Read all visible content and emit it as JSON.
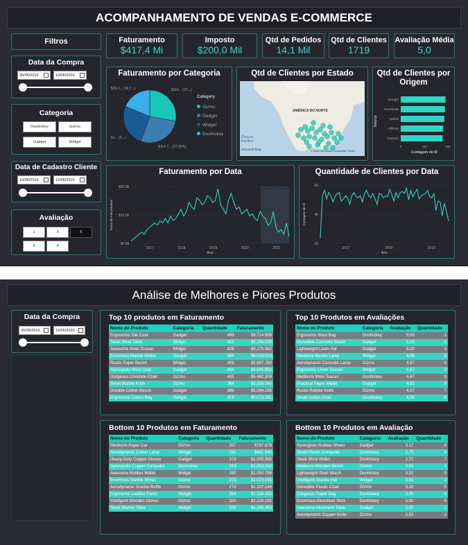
{
  "header": {
    "title": "ACOMPANHAMENTO DE VENDAS E-COMMERCE"
  },
  "filters": {
    "title": "Filtros",
    "data_compra": {
      "label": "Data da Compra",
      "start": "30/06/2016",
      "end": "19/06/2020"
    },
    "categoria": {
      "label": "Categoria",
      "options": [
        "Doohickey",
        "Gizmo",
        "Gadget",
        "Widget"
      ]
    },
    "data_cadastro": {
      "label": "Data de Cadastro Cliente",
      "start": "19/06/2016",
      "end": "19/06/2019"
    },
    "avaliacao": {
      "label": "Avaliação",
      "options": [
        "1",
        "3",
        "5",
        "2",
        "4"
      ],
      "selected": "5"
    }
  },
  "kpis": [
    {
      "label": "Faturamento",
      "value": "$417,4 Mi"
    },
    {
      "label": "Imposto",
      "value": "$200,0 Mil"
    },
    {
      "label": "Qtd de Pedidos",
      "value": "14,1 Mil"
    },
    {
      "label": "Qtd de Clientes",
      "value": "1719"
    },
    {
      "label": "Avaliação Média",
      "value": "5,0"
    }
  ],
  "pie": {
    "title": "Faturamento por Categoria",
    "legend_title": "Category",
    "labels": [
      "$116... (27...)",
      "$78.2... (18.7...)",
      "$1... (2...)",
      "$114.7... (27.69%)"
    ]
  },
  "map": {
    "title": "Qtd de Clientes por Estado",
    "region_label": "AMÉRICA DO NORTE",
    "ocean_label": "Oceano Pacífico",
    "brand": "Microsoft Bing",
    "copyright": "© 2024 Microsoft Corporation  Terms"
  },
  "colors": {
    "accent": "#3fd8c8",
    "gizmo": "#17c7b7",
    "gadget": "#3b7fb0",
    "widget": "#1a5c96",
    "doohickey": "#3bb0e8"
  },
  "origem": {
    "title": "Qtd de Clientes por Origem",
    "ylabel": "Source",
    "xlabel": "Contagem de ID",
    "ticks": [
      "0",
      "200",
      "400"
    ]
  },
  "fat_data": {
    "title": "Faturamento por Data",
    "ylabel": "Soma de Faturamento",
    "xlabel": "Ano",
    "yticks": [
      "$20 Mi",
      "$10 Mi",
      "$0 Mi"
    ],
    "xticks": [
      "2017",
      "2018",
      "2019",
      "2020",
      "2021"
    ]
  },
  "qtd_data": {
    "title": "Quantidade de Clientes por Data",
    "ylabel": "Contagem de ID",
    "xlabel": "Ano",
    "yticks": [
      "60",
      "40",
      "20"
    ],
    "xticks": [
      "2017",
      "2018",
      "2019"
    ]
  },
  "chart_data": [
    {
      "type": "pie",
      "title": "Faturamento por Categoria",
      "categories": [
        "Gizmo",
        "Gadget",
        "Widget",
        "Doohickey"
      ],
      "values": [
        27.9,
        27.69,
        25.7,
        18.7
      ]
    },
    {
      "type": "bar",
      "title": "Qtd de Clientes por Origem",
      "categories": [
        "Google",
        "Facebook",
        "Twitter",
        "Affiliate",
        "Organic"
      ],
      "values": [
        380,
        375,
        370,
        360,
        355
      ],
      "xlim": [
        0,
        400
      ]
    },
    {
      "type": "line",
      "title": "Faturamento por Data",
      "xlabel": "Ano",
      "ylabel": "Soma de Faturamento",
      "ylim": [
        0,
        25
      ],
      "series": [
        {
          "values": [
            1,
            2,
            3,
            4,
            5,
            4,
            6,
            7,
            8,
            9,
            8,
            10,
            9,
            11,
            9,
            12,
            10,
            11,
            13,
            15,
            12,
            14,
            18,
            16,
            15,
            20,
            19,
            17,
            18,
            21,
            20,
            18,
            19,
            24,
            17,
            15,
            13,
            19,
            22,
            18,
            15,
            16,
            13,
            14,
            15,
            12,
            13,
            11,
            10,
            14,
            12,
            11,
            8,
            9,
            14,
            7,
            5,
            6,
            4,
            9,
            3
          ]
        }
      ]
    },
    {
      "type": "line",
      "title": "Quantidade de Clientes por Data",
      "xlabel": "Ano",
      "ylabel": "Contagem de ID",
      "ylim": [
        10,
        65
      ],
      "series": [
        {
          "values": [
            15,
            55,
            60,
            52,
            58,
            55,
            49,
            54,
            57,
            58,
            50,
            52,
            55,
            53,
            47,
            55,
            58,
            54,
            53,
            55,
            49,
            57,
            60,
            55,
            53,
            57,
            52,
            47,
            57,
            56,
            53,
            55,
            54,
            61,
            56,
            50,
            58,
            53,
            58,
            59,
            57,
            62,
            51,
            60,
            54,
            58,
            61,
            52,
            55,
            56,
            57,
            60,
            54,
            53,
            57,
            41,
            50,
            49,
            36,
            48,
            40,
            31
          ]
        }
      ]
    }
  ],
  "page2": {
    "title": "Análise de Melhores e Piores Produtos",
    "filter": {
      "label": "Data da Compra",
      "start": "30/06/2016",
      "end": "19/06/2020"
    },
    "top_fat": {
      "title": "Top 10 produtos em Faturamento",
      "columns": [
        "Nome do Produto",
        "Categoria",
        "Quantidade",
        "Faturamento"
      ],
      "rows": [
        [
          "Ergonomic Silk Coat",
          "Gadget",
          "498",
          "$6.714.909"
        ],
        [
          "Sleek Steel Table",
          "Widget",
          "483",
          "$6.256.039"
        ],
        [
          "Awesome Steel Toucan",
          "Widget",
          "428",
          "$6.175.562"
        ],
        [
          "Enormous Marble Wallet",
          "Gadget",
          "494",
          "$6.014.013"
        ],
        [
          "Rustic Paper Bench",
          "Widget",
          "406",
          "$5.697.760"
        ],
        [
          "Synergistic Wool Coat",
          "Gadget",
          "434",
          "$5.541.983"
        ],
        [
          "Gorgeous Concrete Chair",
          "Gizmo",
          "435",
          "$5.462.309"
        ],
        [
          "Small Marble Knife",
          "Gizmo",
          "364",
          "$5.259.040"
        ],
        [
          "Durable Cotton Bench",
          "Gadget",
          "396",
          "$5.094.185"
        ],
        [
          "Ergonomic Cotton Bag",
          "Gadget",
          "416",
          "$5.073.261"
        ]
      ]
    },
    "top_aval": {
      "title": "Top 10 Produtos em Avaliações",
      "columns": [
        "Nome do Produto",
        "Categoria",
        "Avaliação",
        "Quantidade"
      ],
      "rows": [
        [
          "Ergonomic Wool Bag",
          "Doohickey",
          "5,00",
          "1"
        ],
        [
          "Incredible Concrete Watch",
          "Gadget",
          "5,00",
          "1"
        ],
        [
          "Lightweight Linen Hat",
          "Gadget",
          "5,00",
          "1"
        ],
        [
          "Mediocre Marble Lamp",
          "Widget",
          "4,88",
          "8"
        ],
        [
          "Aerodynamic Concrete Lamp",
          "Gizmo",
          "4,67",
          "6"
        ],
        [
          "Ergonomic Linen Toucan",
          "Widget",
          "4,67",
          "3"
        ],
        [
          "Mediocre Wool Toucan",
          "Doohickey",
          "4,67",
          "6"
        ],
        [
          "Practical Paper Wallet",
          "Gadget",
          "4,63",
          "8"
        ],
        [
          "Rustic Rubber Knife",
          "Gizmo",
          "4,57",
          "7"
        ],
        [
          "Small Cotton Chair",
          "Doohickey",
          "4,56",
          "9"
        ]
      ]
    },
    "bot_fat": {
      "title": "Bottom 10 Produtos em Faturamento",
      "columns": [
        "Nome do Produto",
        "Categoria",
        "Quantidade",
        "Faturamento"
      ],
      "rows": [
        [
          "Mediocre Paper Car",
          "Gizmo",
          "357",
          "$797.678"
        ],
        [
          "Aerodynamic Cotton Lamp",
          "Widget",
          "261",
          "$841.940"
        ],
        [
          "Heavy-Duty Copper Gloves",
          "Gadget",
          "373",
          "$1.000.365"
        ],
        [
          "Synergistic Copper Computer",
          "Doohickey",
          "319",
          "$1.053.163"
        ],
        [
          "Awesome Rubber Wallet",
          "Widget",
          "290",
          "$1.053.798"
        ],
        [
          "Enormous Marble Shoes",
          "Gizmo",
          "373",
          "$1.073.181"
        ],
        [
          "Aerodynamic Granite Bottle",
          "Gizmo",
          "270",
          "$1.107.144"
        ],
        [
          "Ergonomic Leather Pants",
          "Widget",
          "364",
          "$1.126.422"
        ],
        [
          "Intelligent Wooden Gloves",
          "Gizmo",
          "320",
          "$1.135.192"
        ],
        [
          "Sleek Marble Table",
          "Widget",
          "332",
          "$1.168.463"
        ]
      ]
    },
    "bot_aval": {
      "title": "Bottom 10 Produtos em Avaliação",
      "columns": [
        "Nome do Produto",
        "Categoria",
        "Avaliação",
        "Quantidade"
      ],
      "rows": [
        [
          "Synergistic Rubber Shoes",
          "Gadget",
          "3,17",
          "6"
        ],
        [
          "Small Plastic Computer",
          "Doohickey",
          "2,75",
          "4"
        ],
        [
          "Sleek Wool Wallet",
          "Doohickey",
          "2,71",
          "7"
        ],
        [
          "Mediocre Wooden Bench",
          "Gizmo",
          "2,00",
          "1"
        ],
        [
          "Lightweight Steel Watch",
          "Doohickey",
          "3,20",
          "5"
        ],
        [
          "Intelligent Granite Hat",
          "Widget",
          "3,00",
          "2"
        ],
        [
          "Incredible Plastic Chair",
          "Gizmo",
          "3,20",
          "5"
        ],
        [
          "Gorgeous Paper Bag",
          "Doohickey",
          "3,00",
          "4"
        ],
        [
          "Enormous Aluminum Shirt",
          "Doohickey",
          "3,00",
          "5"
        ],
        [
          "Awesome Aluminum Table",
          "Gadget",
          "2,00",
          "1"
        ],
        [
          "Aerodynamic Copper Knife",
          "Gizmo",
          "2,50",
          "2"
        ]
      ]
    }
  }
}
